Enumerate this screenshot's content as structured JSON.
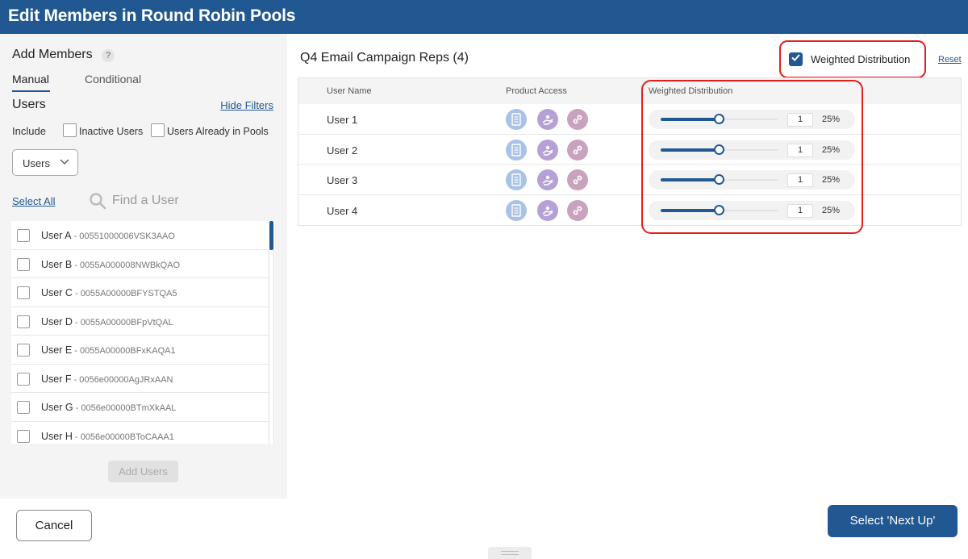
{
  "window": {
    "title": "Edit Members in Round Robin Pools"
  },
  "left_panel": {
    "heading": "Add Members",
    "help_glyph": "?",
    "tabs": [
      {
        "label": "Manual",
        "active": true
      },
      {
        "label": "Conditional",
        "active": false
      }
    ],
    "users_heading": "Users",
    "hide_filters": "Hide Filters",
    "include_label": "Include",
    "filters": [
      {
        "label": "Inactive Users",
        "checked": false
      },
      {
        "label": "Users Already in Pools",
        "checked": false
      }
    ],
    "select_value": "Users",
    "select_all": "Select All",
    "search_placeholder": "Find a User",
    "users": [
      {
        "name": "User A",
        "sep": " - ",
        "id": "00551000006VSK3AAO"
      },
      {
        "name": "User B",
        "sep": " - ",
        "id": "0055A000008NWBkQAO"
      },
      {
        "name": "User C",
        "sep": " - ",
        "id": "0055A00000BFYSTQA5"
      },
      {
        "name": "User D",
        "sep": " - ",
        "id": "0055A00000BFpVtQAL"
      },
      {
        "name": "User E",
        "sep": " - ",
        "id": "0055A00000BFxKAQA1"
      },
      {
        "name": "User F",
        "sep": " - ",
        "id": "0056e00000AgJRxAAN"
      },
      {
        "name": "User G",
        "sep": " - ",
        "id": "0056e00000BTmXkAAL"
      },
      {
        "name": "User H",
        "sep": " - ",
        "id": "0056e00000BToCAAA1"
      }
    ],
    "add_users_button": "Add Users"
  },
  "pool": {
    "title": "Q4 Email Campaign Reps (4)",
    "weighted_distribution": {
      "label": "Weighted Distribution",
      "checked": true
    },
    "reset": "Reset",
    "columns": {
      "user_name": "User Name",
      "product_access": "Product Access",
      "weighted_distribution": "Weighted Distribution"
    },
    "members": [
      {
        "name": "User 1",
        "weight": "1",
        "percent": "25%",
        "slider_level": 0.5
      },
      {
        "name": "User 2",
        "weight": "1",
        "percent": "25%",
        "slider_level": 0.5
      },
      {
        "name": "User 3",
        "weight": "1",
        "percent": "25%",
        "slider_level": 0.5
      },
      {
        "name": "User 4",
        "weight": "1",
        "percent": "25%",
        "slider_level": 0.5
      }
    ],
    "product_icons": [
      "document-icon",
      "hand-icon",
      "link-icon"
    ]
  },
  "footer": {
    "cancel": "Cancel",
    "next": "Select 'Next Up'"
  },
  "colors": {
    "primary": "#215891",
    "highlight": "#e21f1f",
    "doc_icon": "#a8c3e6",
    "hand_icon": "#b6a1d7",
    "link_icon": "#c9a2be"
  }
}
